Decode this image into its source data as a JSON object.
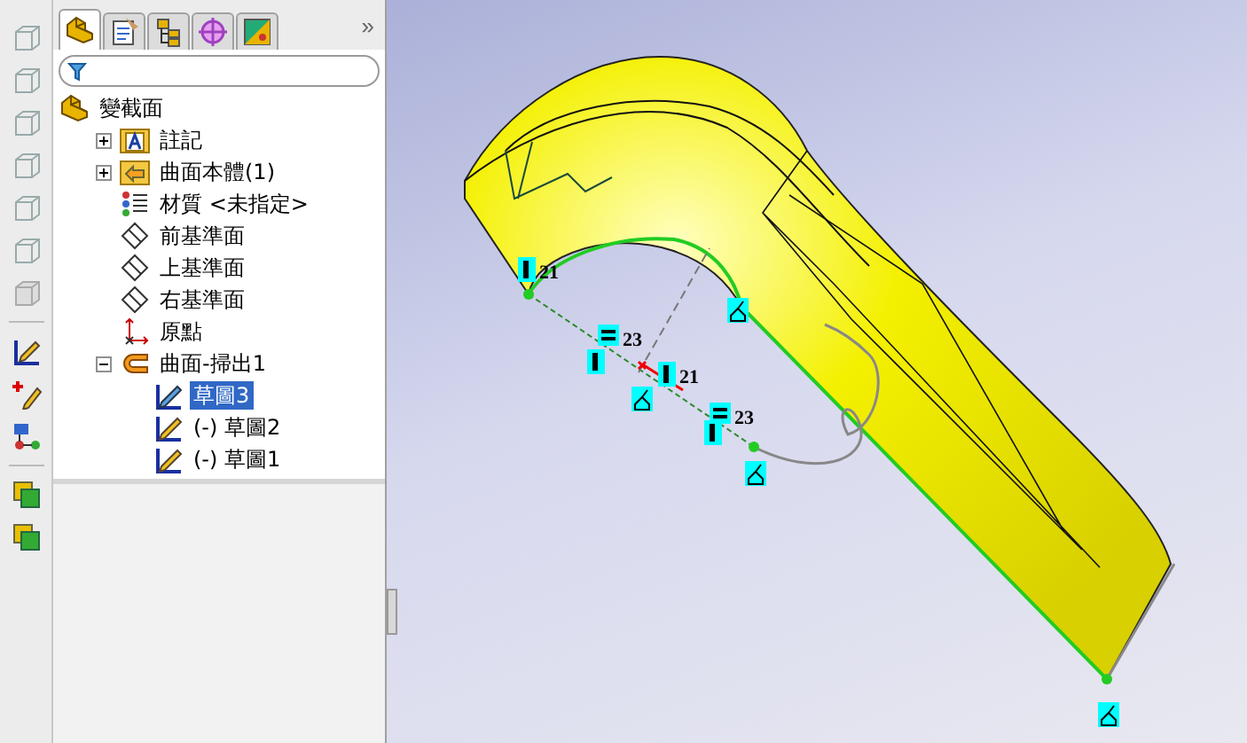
{
  "panel_tabs": [
    {
      "kind": "part",
      "selected": true
    },
    {
      "kind": "property",
      "selected": false
    },
    {
      "kind": "config",
      "selected": false
    },
    {
      "kind": "target",
      "selected": false
    },
    {
      "kind": "display",
      "selected": false
    }
  ],
  "panel_more": "»",
  "tree": {
    "label": "變截面",
    "kind": "part",
    "children": [
      {
        "label": "註記",
        "kind": "annotations",
        "expanded": false,
        "selected": false
      },
      {
        "label": "曲面本體(1)",
        "kind": "surface-folder",
        "expanded": false,
        "selected": false
      },
      {
        "label": "材質 <未指定>",
        "kind": "material",
        "selected": false
      },
      {
        "label": "前基準面",
        "kind": "plane",
        "selected": false
      },
      {
        "label": "上基準面",
        "kind": "plane",
        "selected": false
      },
      {
        "label": "右基準面",
        "kind": "plane",
        "selected": false
      },
      {
        "label": "原點",
        "kind": "origin",
        "selected": false
      },
      {
        "label": "曲面-掃出1",
        "kind": "sweep",
        "expanded": true,
        "selected": false,
        "children": [
          {
            "label": "草圖3",
            "kind": "sketch-active",
            "selected": true
          },
          {
            "label": "(-) 草圖2",
            "kind": "sketch",
            "selected": false
          },
          {
            "label": "(-) 草圖1",
            "kind": "sketch",
            "selected": false
          }
        ]
      }
    ]
  },
  "relations": [
    {
      "kind": "vertical",
      "text": "21"
    },
    {
      "kind": "equal",
      "text": "23"
    },
    {
      "kind": "vertical"
    },
    {
      "kind": "vertical",
      "text": "21"
    },
    {
      "kind": "equal",
      "text": "23"
    },
    {
      "kind": "vertical"
    },
    {
      "kind": "pierce"
    },
    {
      "kind": "pierce"
    },
    {
      "kind": "pierce"
    },
    {
      "kind": "pierce"
    }
  ]
}
